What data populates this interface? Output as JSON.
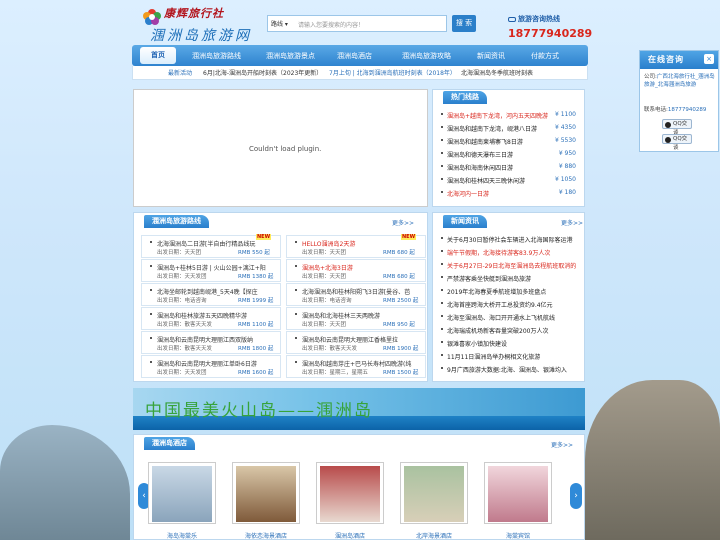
{
  "header": {
    "logo_text": "康辉旅行社",
    "logo_sub": "涠洲岛旅游网",
    "search_select": "路线",
    "search_placeholder": "请输入您要搜索的内容！",
    "search_button": "搜 索",
    "hotline_label": "旅游咨询热线",
    "hotline_number": "18777940289"
  },
  "nav": {
    "items": [
      "首页",
      "涠洲岛旅游路线",
      "涠洲岛旅游景点",
      "涠洲岛酒店",
      "涠洲岛旅游攻略",
      "新闻资讯",
      "付款方式"
    ]
  },
  "ticker": {
    "label": "最新活动",
    "items": [
      "6月|北海-涠洲岛开船时刻表（2023年更新）",
      "7月上旬 | 北海到涠洲岛航班时刻表（2018年）",
      "北海涠洲岛冬季航班时刻表"
    ]
  },
  "plugin_text": "Couldn't load plugin.",
  "hot_routes": {
    "title": "热门线路",
    "items": [
      {
        "name": "涠洲岛+越南下龙湾，河内五天四晚游",
        "price": "¥ 1100",
        "red": true
      },
      {
        "name": "涠洲岛和越南下龙湾，岘港八日游",
        "price": "¥ 4350",
        "red": false
      },
      {
        "name": "涠洲岛和越南柬埔寨飞8日游",
        "price": "¥ 5530",
        "red": false
      },
      {
        "name": "涠洲岛和德天瀑布三日游",
        "price": "¥ 950",
        "red": false
      },
      {
        "name": "涠洲岛和海南休闲四日游",
        "price": "¥ 880",
        "red": false
      },
      {
        "name": "涠洲岛和桂林四天三晚休闲游",
        "price": "¥ 1050",
        "red": false
      },
      {
        "name": "北海河内一日游",
        "price": "¥ 180",
        "red": true
      }
    ]
  },
  "routes": {
    "title": "涠洲岛旅游路线",
    "more": "更多>>",
    "items": [
      {
        "name": "北海涠洲岛二日游[半自由行精品线玩",
        "meta": "出发日期：天天团",
        "price": "RMB 550 起",
        "new": true,
        "red": false
      },
      {
        "name": "HELLO涠洲岛2天游",
        "meta": "出发日期：天天团",
        "price": "RMB 680 起",
        "new": true,
        "red": true
      },
      {
        "name": "涠洲岛+桂林5日游 | 火山公园+漓江+阳",
        "meta": "出发日期：天天发团",
        "price": "RMB 1380 起",
        "new": false,
        "red": false
      },
      {
        "name": "涠洲岛+北海3日游",
        "meta": "出发日期：天天团",
        "price": "RMB 680 起",
        "new": false,
        "red": true
      },
      {
        "name": "北海坐邮轮到越南岘港_5天4晚【探庄",
        "meta": "出发日期：电话咨询",
        "price": "RMB 1999 起",
        "new": false,
        "red": false
      },
      {
        "name": "北海涠洲岛和桂林阳朔飞3日游[曼谷、芭",
        "meta": "出发日期：电话咨询",
        "price": "RMB 2500 起",
        "new": false,
        "red": false
      },
      {
        "name": "涠洲岛和桂林旅游五天四晚精华游",
        "meta": "出发日期：散客天天发",
        "price": "RMB 1100 起",
        "new": false,
        "red": false
      },
      {
        "name": "涠洲岛和北海桂林三天两晚游",
        "meta": "出发日期：天天团",
        "price": "RMB 950 起",
        "new": false,
        "red": false
      },
      {
        "name": "涠洲岛和云南昆明大理丽江西双版纳",
        "meta": "出发日期：散客天天发",
        "price": "RMB 1800 起",
        "new": false,
        "red": false
      },
      {
        "name": "涠洲岛和云南昆明大理丽江香格里拉",
        "meta": "出发日期：散客天天发",
        "price": "RMB 1900 起",
        "new": false,
        "red": false
      },
      {
        "name": "涠洲岛和云南昆明大理丽江单卧6日游",
        "meta": "出发日期：天天发团",
        "price": "RMB 1600 起",
        "new": false,
        "red": false
      },
      {
        "name": "涠洲岛和越南芽庄+巴马长寿村四晚游(纯",
        "meta": "出发日期：星期三，星期五",
        "price": "RMB 1500 起",
        "new": false,
        "red": false
      }
    ]
  },
  "news": {
    "title": "新闻资讯",
    "more": "更多>>",
    "items": [
      {
        "text": "关于6月30日暂停社会车辆进入北海国际客运港",
        "red": false
      },
      {
        "text": "端午节假期，北海接待游客83.9万人次",
        "red": true
      },
      {
        "text": "关于6月27日-29日北海至涠洲岛去程航班取消的",
        "red": true
      },
      {
        "text": "严禁游客乘坐快艇到涠洲岛旅游",
        "red": false
      },
      {
        "text": "2019年北海春夏季航班增加多班盘点",
        "red": false
      },
      {
        "text": "北海首座跨海大桥开工总投资约9.4亿元",
        "red": false
      },
      {
        "text": "北海至涠洲岛、海口开开通水上飞机航线",
        "red": false
      },
      {
        "text": "北海瑞成机场新客吞量突破200万人次",
        "red": false
      },
      {
        "text": "银滩喜家小镇加快建设",
        "red": false
      },
      {
        "text": "11月11日涠洲岛举办桐相文化旅游",
        "red": false
      },
      {
        "text": "9月广西旅游大数据:北海、涠洲岛、银滩均入",
        "red": false
      }
    ]
  },
  "banner_text": "中国最美火山岛——涠洲岛",
  "hotels": {
    "title": "涠洲岛酒店",
    "more": "更多>>",
    "items": [
      "海岛海棠乐",
      "海依恋海景酒店",
      "涠洲岛酒店",
      "北岸海景酒店",
      "海棠宾馆"
    ]
  },
  "online": {
    "title": "在线咨询",
    "close": "×",
    "company_label": "公司:",
    "company": "广西北海旅行社_涠洲岛旅游_北海涠洲岛旅游",
    "phone_label": "联系电话:",
    "phone": "18777940289",
    "qq1": "QQ交谈",
    "qq2": "QQ交谈"
  }
}
